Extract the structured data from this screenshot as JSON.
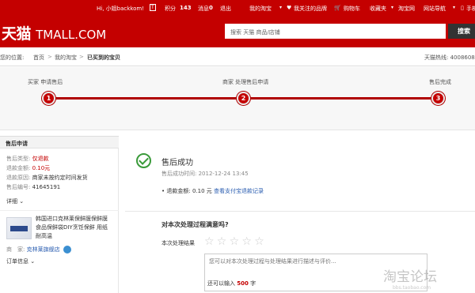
{
  "topbar": {
    "greeting": "Hi, 小姐backkom!",
    "level_badge": "T",
    "points_label": "积分",
    "points_value": "143",
    "messages_label": "消息",
    "messages_value": "0",
    "logout": "退出",
    "my_taobao": "我的淘宝",
    "favorites": "我关注的品牌",
    "cart": "购物车",
    "bookmarks": "收藏夹",
    "taobao": "淘宝网",
    "site_nav": "网站导航",
    "mobile": "手机"
  },
  "header": {
    "logo_cn": "天猫",
    "logo_en": "TMALL.COM",
    "search_placeholder": "搜索 天猫 商品/店铺",
    "search_button": "搜索"
  },
  "breadcrumb": {
    "prefix": "您的位置:",
    "home": "首页",
    "my_taobao": "我的淘宝",
    "current": "已买到的宝贝",
    "hotline": "天猫热线: 4008608"
  },
  "steps": [
    {
      "number": "1",
      "label": "买家 申请售后"
    },
    {
      "number": "2",
      "label": "商家 处理售后申请"
    },
    {
      "number": "3",
      "label": "售后完成"
    }
  ],
  "sidebar": {
    "title": "售后申请",
    "fields": [
      {
        "key": "售后类型:",
        "value": "仅退款",
        "highlight": true
      },
      {
        "key": "退款金额:",
        "value": "0.10元",
        "highlight": true
      },
      {
        "key": "退款原因:",
        "value": "商家未按约定时间发货",
        "highlight": false
      },
      {
        "key": "售后编号:",
        "value": "41645191",
        "highlight": false
      }
    ],
    "detail": "详细",
    "product_title": "韩国进口克林莱保鲜膜保鲜膜 食品保鲜袋DIY烹饪保鲜 用纸 耐高温",
    "shop_label": "商　家:",
    "shop_name": "克林莱旗舰店",
    "order_info": "订单信息"
  },
  "main": {
    "success_title": "售后成功",
    "success_time": "售后成功时间: 2012-12-24 13:45",
    "refund_label": "• 退款金额:",
    "refund_amount": "0.10 元",
    "refund_link": "查看支付宝退款记录",
    "question": "对本次处理过程满意吗?",
    "rating_label": "本次处理结果",
    "stars": [
      "☆",
      "☆",
      "☆",
      "☆",
      "☆"
    ],
    "textarea_placeholder": "您可以对本次处理过程与处理结果进行描述与评价...",
    "count_prefix": "还可以输入",
    "count_value": "500",
    "count_suffix": "字"
  },
  "watermark": {
    "text": "淘宝论坛",
    "sub": "bbs.taobao.com"
  },
  "colors": {
    "brand_red": "#c40000",
    "link_blue": "#2a5db0",
    "success_green": "#3a9a3a"
  }
}
